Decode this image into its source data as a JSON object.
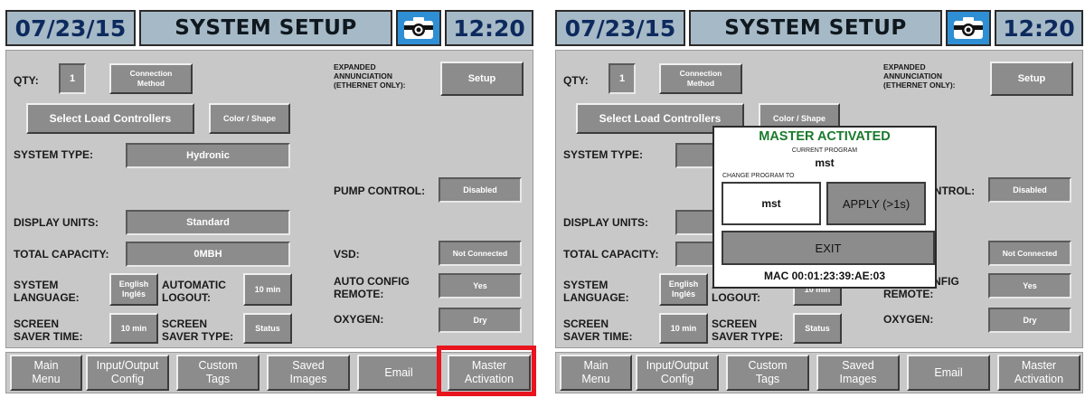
{
  "header": {
    "date": "07/23/15",
    "title": "SYSTEM SETUP",
    "time": "12:20",
    "camera_icon": "camera-icon"
  },
  "labels": {
    "qty": "QTY:",
    "expanded": "EXPANDED\nANNUNCIATION\n(ETHERNET ONLY):",
    "system_type": "SYSTEM TYPE:",
    "pump_control": "PUMP CONTROL:",
    "display_units": "DISPLAY UNITS:",
    "total_capacity": "TOTAL CAPACITY:",
    "vsd": "VSD:",
    "system_language": "SYSTEM\nLANGUAGE:",
    "automatic_logout": "AUTOMATIC\nLOGOUT:",
    "auto_config_remote": "AUTO CONFIG\nREMOTE:",
    "screen_saver_time": "SCREEN\nSAVER TIME:",
    "screen_saver_type": "SCREEN\nSAVER TYPE:",
    "oxygen": "OXYGEN:"
  },
  "values": {
    "qty": "1",
    "connection_method": "Connection\nMethod",
    "setup": "Setup",
    "select_load_controllers": "Select Load Controllers",
    "color_shape": "Color / Shape",
    "system_type": "Hydronic",
    "pump_control": "Disabled",
    "display_units": "Standard",
    "total_capacity": "0MBH",
    "vsd": "Not Connected",
    "system_language": "English\nInglés",
    "automatic_logout": "10 min",
    "auto_config_remote": "Yes",
    "screen_saver_time": "10 min",
    "screen_saver_type": "Status",
    "oxygen": "Dry"
  },
  "nav": {
    "main_menu": "Main\nMenu",
    "io_config": "Input/Output\nConfig",
    "custom_tags": "Custom\nTags",
    "saved_images": "Saved\nImages",
    "email": "Email",
    "master_activation": "Master\nActivation"
  },
  "modal": {
    "title": "MASTER ACTIVATED",
    "current_program_label": "CURRENT PROGRAM",
    "current_program": "mst",
    "change_program_label": "CHANGE PROGRAM TO",
    "change_program_value": "mst",
    "apply": "APPLY (>1s)",
    "exit": "EXIT",
    "mac": "MAC 00:01:23:39:AE:03"
  },
  "colors": {
    "accent_title": "#1a7a2c",
    "highlight": "#e8141e",
    "header_bg": "#a6b9c6",
    "camera_bg": "#2f8fd4"
  }
}
